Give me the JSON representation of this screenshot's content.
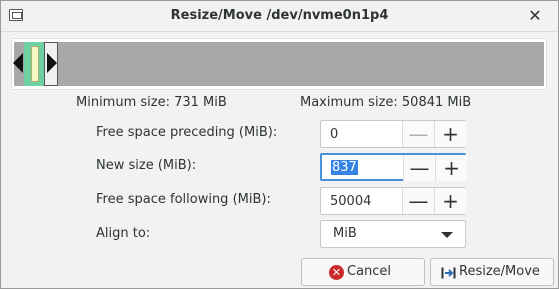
{
  "window": {
    "title": "Resize/Move /dev/nvme0n1p4",
    "icon": "window-icon",
    "close_icon": "close-icon"
  },
  "graph": {
    "used_fraction": 0.015,
    "partition_fraction": 0.016,
    "colors": {
      "partition": "#6fd0a4",
      "used": "#f7f7c3",
      "unallocated": "#a8a8a8"
    }
  },
  "limits": {
    "minimum": "Minimum size: 731 MiB",
    "maximum": "Maximum size: 50841 MiB"
  },
  "fields": {
    "preceding": {
      "label": "Free space preceding (MiB):",
      "value": "0",
      "minus": "—",
      "plus": "+"
    },
    "new_size": {
      "label": "New size (MiB):",
      "value": "837",
      "minus": "—",
      "plus": "+"
    },
    "following": {
      "label": "Free space following (MiB):",
      "value": "50004",
      "minus": "—",
      "plus": "+"
    },
    "align": {
      "label": "Align to:",
      "value": "MiB"
    }
  },
  "buttons": {
    "cancel": "Cancel",
    "resize_move": "Resize/Move"
  },
  "accent": "#3584e4"
}
